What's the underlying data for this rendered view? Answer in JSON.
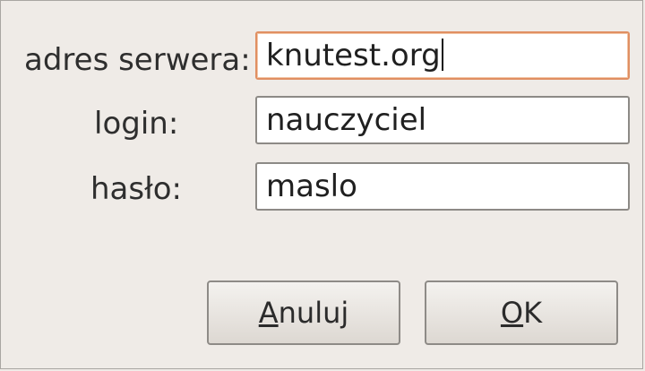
{
  "form": {
    "server_label": "adres serwera:",
    "server_value": "knutest.org",
    "login_label": "login:",
    "login_value": "nauczyciel",
    "password_label": "hasło:",
    "password_value": "maslo"
  },
  "buttons": {
    "cancel": {
      "mnemonic": "A",
      "rest": "nuluj"
    },
    "ok": {
      "mnemonic": "O",
      "rest": "K"
    }
  }
}
